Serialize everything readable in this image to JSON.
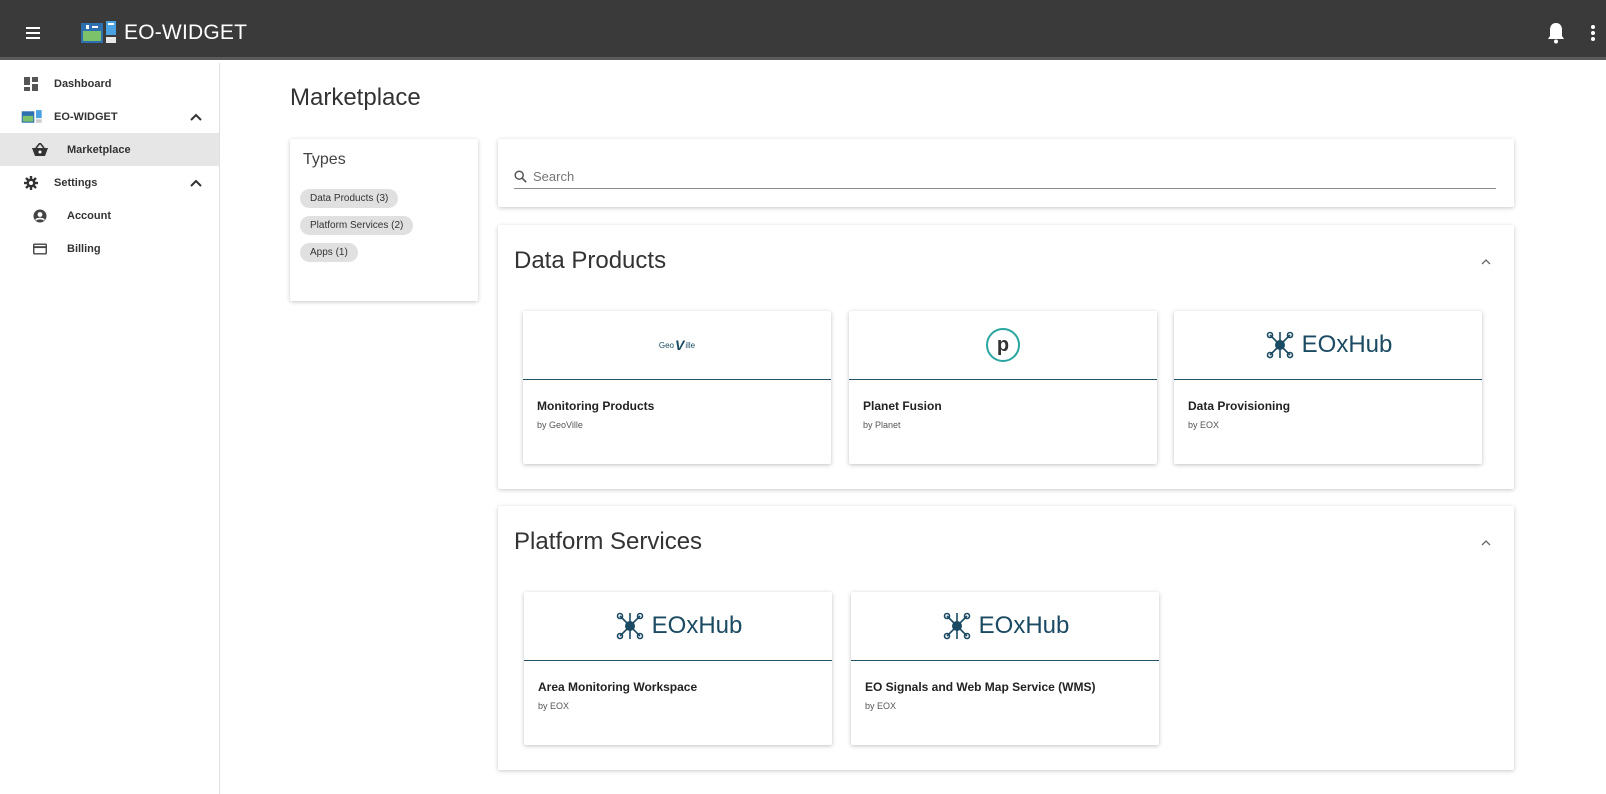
{
  "app": {
    "title": "EO-WIDGET",
    "logo_icon": "eo-widget-logo"
  },
  "topbar": {
    "menu_icon": "hamburger-menu-icon",
    "bell_icon": "bell-icon",
    "more_icon": "more-vert-icon"
  },
  "sidebar": {
    "items": [
      {
        "label": "Dashboard",
        "icon": "dashboard-icon"
      },
      {
        "label": "EO-WIDGET",
        "icon": "eo-widget-logo",
        "expanded": true
      },
      {
        "label": "Marketplace",
        "icon": "basket-icon",
        "active": true
      },
      {
        "label": "Settings",
        "icon": "gear-icon",
        "expanded": true
      },
      {
        "label": "Account",
        "icon": "account-circle-icon"
      },
      {
        "label": "Billing",
        "icon": "credit-card-icon"
      }
    ]
  },
  "main": {
    "title": "Marketplace",
    "types": {
      "title": "Types",
      "chips": [
        "Data Products (3)",
        "Platform Services (2)",
        "Apps (1)"
      ]
    },
    "search": {
      "placeholder": "Search"
    },
    "sections": [
      {
        "title": "Data Products",
        "items": [
          {
            "name": "Monitoring Products",
            "by": "by GeoVille",
            "logo": "geoville-logo",
            "logo_text": "GeoVille"
          },
          {
            "name": "Planet Fusion",
            "by": "by Planet",
            "logo": "planet-logo",
            "logo_text": "p"
          },
          {
            "name": "Data Provisioning",
            "by": "by EOX",
            "logo": "eoxhub-logo",
            "logo_text": "EOxHub"
          }
        ]
      },
      {
        "title": "Platform Services",
        "items": [
          {
            "name": "Area Monitoring Workspace",
            "by": "by EOX",
            "logo": "eoxhub-logo",
            "logo_text": "EOxHub"
          },
          {
            "name": "EO Signals and Web Map Service (WMS)",
            "by": "by EOX",
            "logo": "eoxhub-logo",
            "logo_text": "EOxHub"
          }
        ]
      }
    ]
  },
  "colors": {
    "topbar": "#3a3a3a",
    "brand_blue": "#1b4a63",
    "planet_teal": "#2aa6a0",
    "active_nav": "#e6e6e6"
  }
}
